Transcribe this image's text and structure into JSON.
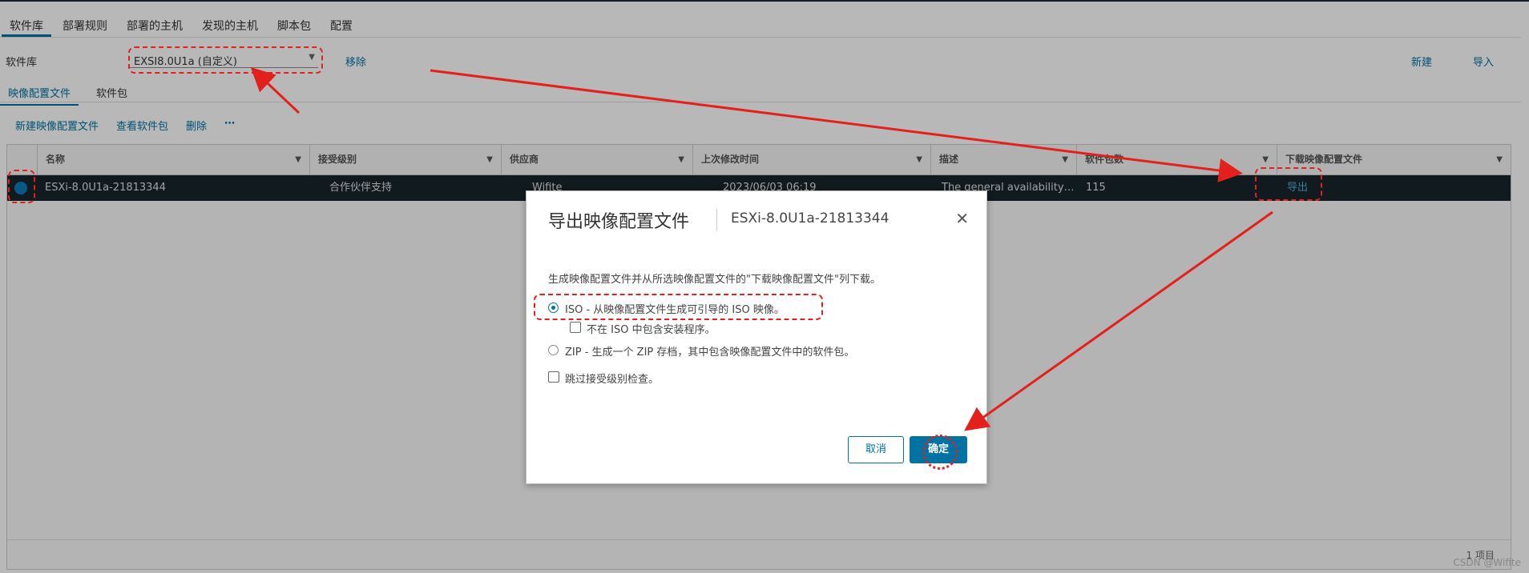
{
  "main_tabs": [
    "软件库",
    "部署规则",
    "部署的主机",
    "发现的主机",
    "脚本包",
    "配置"
  ],
  "depot": {
    "label": "软件库",
    "selected": "EXSI8.0U1a (自定义)",
    "remove": "移除",
    "new": "新建",
    "import": "导入"
  },
  "sub_tabs": [
    "映像配置文件",
    "软件包"
  ],
  "toolbar": {
    "new_profile": "新建映像配置文件",
    "view_packages": "查看软件包",
    "delete": "删除",
    "more": "⋯"
  },
  "grid": {
    "columns": [
      "名称",
      "接受级别",
      "供应商",
      "上次修改时间",
      "描述",
      "软件包数",
      "下载映像配置文件"
    ],
    "row": {
      "name": "ESXi-8.0U1a-21813344",
      "acceptance": "合作伙伴支持",
      "vendor": "Wifite",
      "modified": "2023/06/03 06:19",
      "description": "The general availability ...",
      "packages": "115",
      "download": "导出"
    },
    "count": "1 项目"
  },
  "modal": {
    "title": "导出映像配置文件",
    "subtitle": "ESXi-8.0U1a-21813344",
    "close": "✕",
    "description": "生成映像配置文件并从所选映像配置文件的\"下载映像配置文件\"列下载。",
    "opt_iso": "ISO - 从映像配置文件生成可引导的 ISO 映像。",
    "opt_no_installer": "不在 ISO 中包含安装程序。",
    "opt_zip": "ZIP - 生成一个 ZIP 存档，其中包含映像配置文件中的软件包。",
    "opt_skip": "跳过接受级别检查。",
    "cancel": "取消",
    "ok": "确定"
  },
  "watermark": "CSDN @Wifite",
  "colors": {
    "accent": "#0072a3",
    "annotation": "#e3201c",
    "row_selected": "#17242b"
  }
}
